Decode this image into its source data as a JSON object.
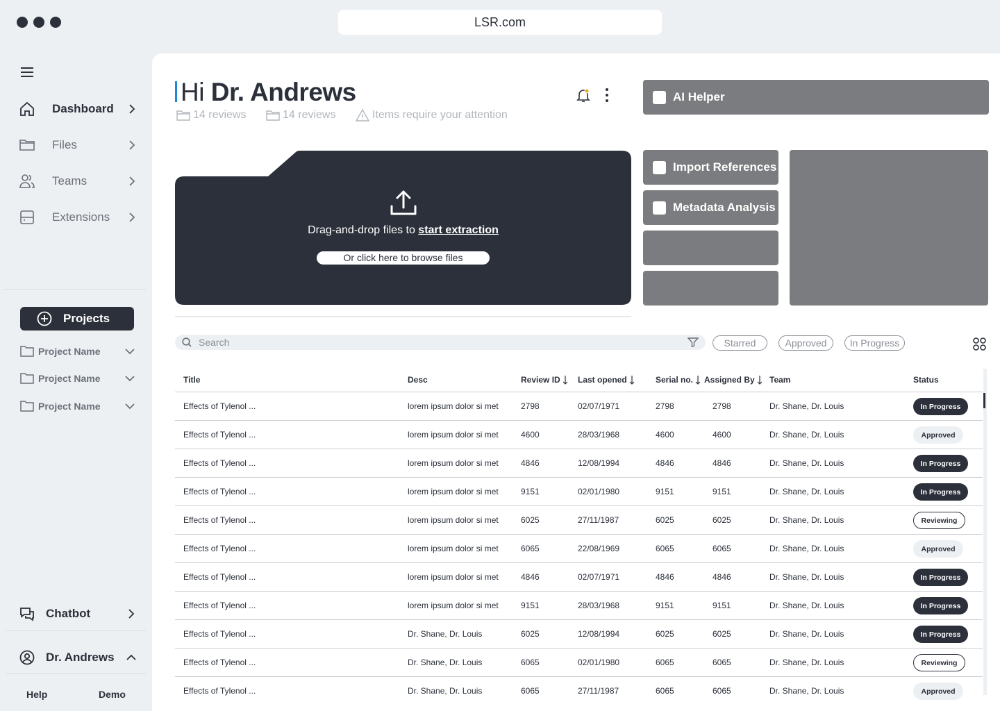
{
  "browser": {
    "url": "LSR.com"
  },
  "sidebar": {
    "nav": [
      {
        "label": "Dashboard",
        "icon": "home-icon",
        "active": true
      },
      {
        "label": "Files",
        "icon": "folder-icon",
        "active": false
      },
      {
        "label": "Teams",
        "icon": "users-icon",
        "active": false
      },
      {
        "label": "Extensions",
        "icon": "server-icon",
        "active": false
      }
    ],
    "projects_label": "Projects",
    "projects": [
      {
        "label": "Project Name"
      },
      {
        "label": "Project Name"
      },
      {
        "label": "Project Name"
      }
    ],
    "chatbot_label": "Chatbot",
    "user_label": "Dr. Andrews",
    "help_label": "Help",
    "demo_label": "Demo"
  },
  "header": {
    "greeting": "Hi",
    "name": "Dr. Andrews",
    "meta": [
      {
        "icon": "folder-icon",
        "text": "14 reviews"
      },
      {
        "icon": "folder-icon",
        "text": "14 reviews"
      },
      {
        "icon": "warning-icon",
        "text": "Items require your attention"
      }
    ]
  },
  "ai_helper": {
    "label": "AI Helper"
  },
  "upload": {
    "text": "Drag-and-drop files to ",
    "link": "start extraction",
    "browse": "Or click here to browse files"
  },
  "tiles": [
    {
      "label": "Import References"
    },
    {
      "label": "Metadata Analysis"
    },
    {
      "label": ""
    },
    {
      "label": ""
    }
  ],
  "search": {
    "placeholder": "Search"
  },
  "filters": [
    "Starred",
    "Approved",
    "In Progress"
  ],
  "table": {
    "columns": [
      "Title",
      "Desc",
      "Review ID",
      "Last opened",
      "Serial no.",
      "Assigned By",
      "Team",
      "Status"
    ],
    "rows": [
      [
        "Effects of Tylenol ...",
        "lorem ipsum dolor si met",
        "2798",
        "02/07/1971",
        "2798",
        "2798",
        "Dr. Shane, Dr. Louis",
        "In Progress"
      ],
      [
        "Effects of Tylenol ...",
        "lorem ipsum dolor si met",
        "4600",
        "28/03/1968",
        "4600",
        "4600",
        "Dr. Shane, Dr. Louis",
        "Approved"
      ],
      [
        "Effects of Tylenol ...",
        "lorem ipsum dolor si met",
        "4846",
        "12/08/1994",
        "4846",
        "4846",
        "Dr. Shane, Dr. Louis",
        "In Progress"
      ],
      [
        "Effects of Tylenol ...",
        "lorem ipsum dolor si met",
        "9151",
        "02/01/1980",
        "9151",
        "9151",
        "Dr. Shane, Dr. Louis",
        "In Progress"
      ],
      [
        "Effects of Tylenol ...",
        "lorem ipsum dolor si met",
        "6025",
        "27/11/1987",
        "6025",
        "6025",
        "Dr. Shane, Dr. Louis",
        "Reviewing"
      ],
      [
        "Effects of Tylenol ...",
        "lorem ipsum dolor si met",
        "6065",
        "22/08/1969",
        "6065",
        "6065",
        "Dr. Shane, Dr. Louis",
        "Approved"
      ],
      [
        "Effects of Tylenol ...",
        "lorem ipsum dolor si met",
        "4846",
        "02/07/1971",
        "4846",
        "4846",
        "Dr. Shane, Dr. Louis",
        "In Progress"
      ],
      [
        "Effects of Tylenol ...",
        "lorem ipsum dolor si met",
        "9151",
        "28/03/1968",
        "9151",
        "9151",
        "Dr. Shane, Dr. Louis",
        "In Progress"
      ],
      [
        "Effects of Tylenol ...",
        "Dr. Shane, Dr. Louis",
        "6025",
        "12/08/1994",
        "6025",
        "6025",
        "Dr. Shane, Dr. Louis",
        "In Progress"
      ],
      [
        "Effects of Tylenol ...",
        "Dr. Shane, Dr. Louis",
        "6065",
        "02/01/1980",
        "6065",
        "6065",
        "Dr. Shane, Dr. Louis",
        "Reviewing"
      ],
      [
        "Effects of Tylenol ...",
        "Dr. Shane, Dr. Louis",
        "6065",
        "27/11/1987",
        "6065",
        "6065",
        "Dr. Shane, Dr. Louis",
        "Approved"
      ]
    ]
  },
  "colors": {
    "dark": "#2b303a",
    "tile": "#7b7c7f",
    "accent": "#1e88d6",
    "notify": "#f2a81d"
  }
}
